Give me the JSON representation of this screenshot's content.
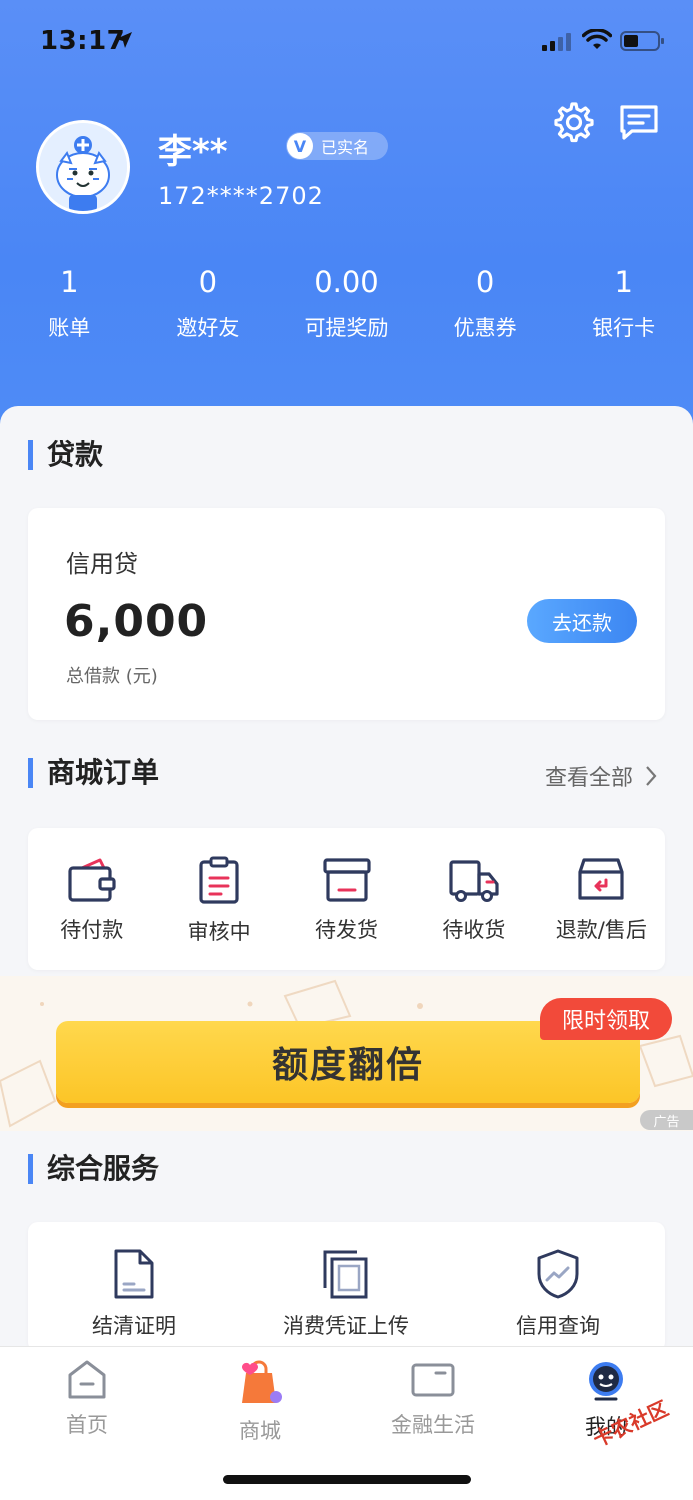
{
  "status_bar": {
    "time": "13:17"
  },
  "profile": {
    "name": "李**",
    "verified_label": "已实名",
    "verified_mark": "V",
    "phone": "172****2702"
  },
  "stats": [
    {
      "value": "1",
      "label": "账单"
    },
    {
      "value": "0",
      "label": "邀好友"
    },
    {
      "value": "0.00",
      "label": "可提奖励"
    },
    {
      "value": "0",
      "label": "优惠券"
    },
    {
      "value": "1",
      "label": "银行卡"
    }
  ],
  "loan": {
    "section_title": "贷款",
    "product_name": "信用贷",
    "amount": "6,000",
    "amount_label": "总借款 (元)",
    "repay_button": "去还款"
  },
  "orders": {
    "section_title": "商城订单",
    "view_all": "查看全部",
    "items": [
      {
        "label": "待付款",
        "icon": "wallet-icon"
      },
      {
        "label": "审核中",
        "icon": "clipboard-icon"
      },
      {
        "label": "待发货",
        "icon": "box-icon"
      },
      {
        "label": "待收货",
        "icon": "truck-icon"
      },
      {
        "label": "退款/售后",
        "icon": "return-box-icon"
      }
    ]
  },
  "banner": {
    "text": "额度翻倍",
    "tag": "限时领取",
    "ad_label": "广告"
  },
  "services": {
    "section_title": "综合服务",
    "items": [
      {
        "label": "结清证明",
        "icon": "document-icon"
      },
      {
        "label": "消费凭证上传",
        "icon": "copy-stack-icon"
      },
      {
        "label": "信用查询",
        "icon": "shield-chart-icon"
      }
    ]
  },
  "tabs": [
    {
      "label": "首页",
      "icon": "home-icon",
      "active": false
    },
    {
      "label": "商城",
      "icon": "shopping-bag-icon",
      "active": false
    },
    {
      "label": "金融生活",
      "icon": "card-icon",
      "active": false
    },
    {
      "label": "我的",
      "icon": "profile-icon",
      "active": true
    }
  ],
  "watermark": "卡农社区",
  "colors": {
    "primary": "#4a86f5",
    "accent_red": "#f24a3a",
    "banner_yellow": "#fcc527",
    "icon_navy": "#2f3a5e",
    "icon_red": "#e8335a"
  }
}
